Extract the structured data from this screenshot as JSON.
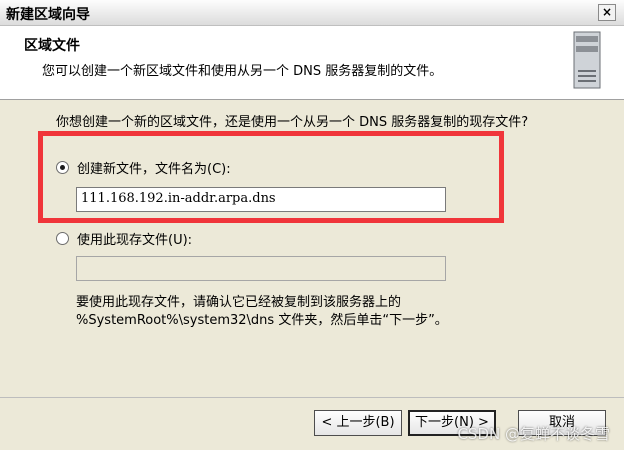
{
  "window": {
    "title": "新建区域向导",
    "close_label": "×"
  },
  "header": {
    "title": "区域文件",
    "subtitle": "您可以创建一个新区域文件和使用从另一个 DNS 服务器复制的文件。"
  },
  "main": {
    "question": "你想创建一个新的区域文件，还是使用一个从另一个 DNS 服务器复制的现存文件?",
    "option_new": {
      "label": "创建新文件，文件名为(C):",
      "checked": true,
      "filename": "111.168.192.in-addr.arpa.dns"
    },
    "option_existing": {
      "label": "使用此现存文件(U):",
      "checked": false,
      "filename": ""
    },
    "hint_line1": "要使用此现存文件，请确认它已经被复制到该服务器上的",
    "hint_line2": "%SystemRoot%\\system32\\dns 文件夹，然后单击“下一步”。"
  },
  "footer": {
    "back_label": "< 上一步(B)",
    "next_label": "下一步(N) >",
    "cancel_label": "取消"
  },
  "watermark": "CSDN @复蝉不谈冬雪",
  "colors": {
    "highlight": "#f0353a",
    "window_bg": "#ece9d8"
  }
}
